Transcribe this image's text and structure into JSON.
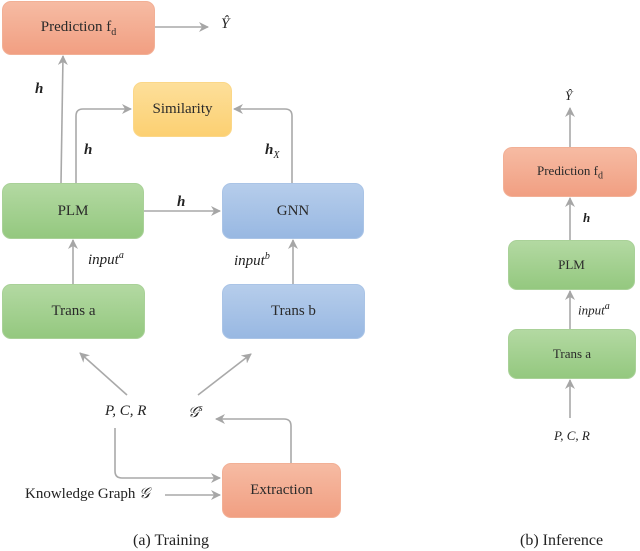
{
  "training": {
    "caption": "(a)  Training",
    "boxes": {
      "prediction": {
        "label": "Prediction f",
        "sub": "d"
      },
      "similarity": {
        "label": "Similarity"
      },
      "plm": {
        "label": "PLM"
      },
      "gnn": {
        "label": "GNN"
      },
      "trans_a": {
        "label": "Trans a"
      },
      "trans_b": {
        "label": "Trans b"
      },
      "extraction": {
        "label": "Extraction"
      }
    },
    "labels": {
      "y_hat": "Ŷ",
      "h_to_prediction": "h",
      "h_to_similarity": "h",
      "h_x": "h",
      "h_x_sub": "X",
      "h_plm_gnn": "h",
      "input_a": "input",
      "input_a_sup": "a",
      "input_b": "input",
      "input_b_sup": "b",
      "pcr": "P, C, R",
      "g_s": "𝒢",
      "g_s_sup": "s",
      "knowledge_graph": "Knowledge Graph ",
      "knowledge_graph_symbol": "𝒢"
    }
  },
  "inference": {
    "caption": "(b)  Inference",
    "boxes": {
      "prediction": {
        "label": "Prediction f",
        "sub": "d"
      },
      "plm": {
        "label": "PLM"
      },
      "trans_a": {
        "label": "Trans a"
      }
    },
    "labels": {
      "y_hat": "Ŷ",
      "h": "h",
      "input_a": "input",
      "input_a_sup": "a",
      "pcr": "P, C, R"
    }
  },
  "colors": {
    "prediction": "#f3a98c",
    "similarity": "#fcd582",
    "plm": "#a3d08f",
    "gnn": "#a7c2e6",
    "arrow": "#a6a6a6"
  }
}
